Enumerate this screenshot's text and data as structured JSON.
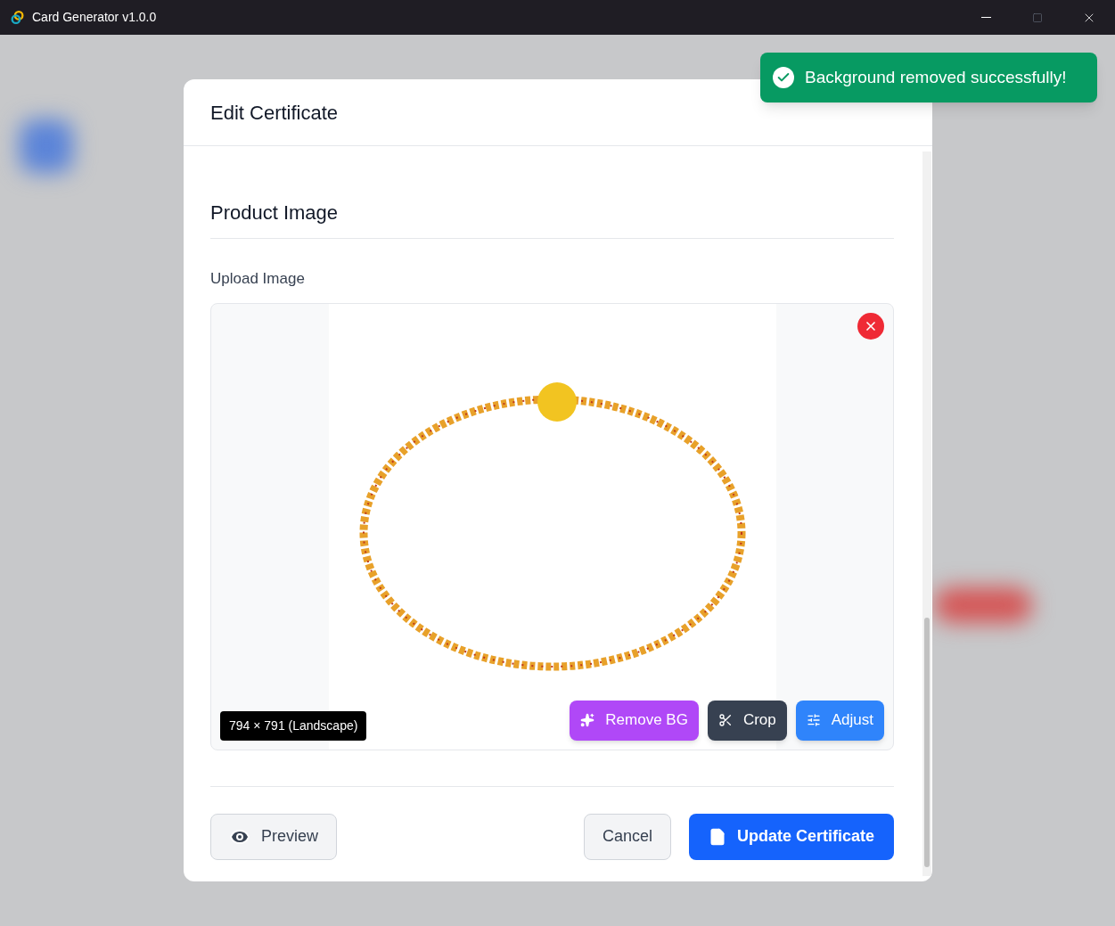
{
  "window": {
    "title": "Card Generator v1.0.0"
  },
  "toast": {
    "message": "Background removed successfully!"
  },
  "modal": {
    "title": "Edit Certificate",
    "section": {
      "heading": "Product Image",
      "field_label": "Upload Image",
      "image": {
        "dimensions": "794 × 791 (Landscape)",
        "actions": [
          {
            "kind": "sparkles",
            "label": "Remove BG"
          },
          {
            "kind": "scissors",
            "label": "Crop"
          },
          {
            "kind": "sliders",
            "label": "Adjust"
          }
        ]
      }
    },
    "footer": {
      "preview": "Preview",
      "cancel": "Cancel",
      "submit": "Update Certificate"
    }
  }
}
